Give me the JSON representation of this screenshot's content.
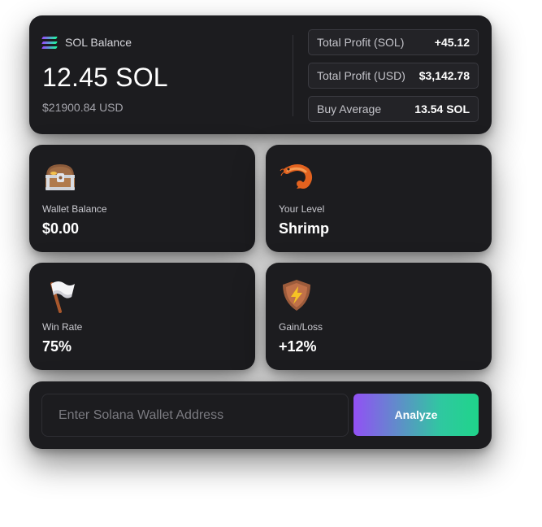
{
  "balance": {
    "label": "SOL Balance",
    "amount": "12.45 SOL",
    "usd": "$21900.84 USD",
    "icon": "solana-logo-icon"
  },
  "stats": [
    {
      "label": "Total Profit (SOL)",
      "value": "+45.12"
    },
    {
      "label": "Total Profit (USD)",
      "value": "$3,142.78"
    },
    {
      "label": "Buy Average",
      "value": "13.54 SOL"
    }
  ],
  "tiles": {
    "wallet": {
      "label": "Wallet Balance",
      "value": "$0.00",
      "icon": "treasure-chest-icon"
    },
    "level": {
      "label": "Your Level",
      "value": "Shrimp",
      "icon": "shrimp-icon"
    },
    "win": {
      "label": "Win Rate",
      "value": "75%",
      "icon": "white-flag-icon"
    },
    "gain": {
      "label": "Gain/Loss",
      "value": "+12%",
      "icon": "lightning-shield-icon"
    }
  },
  "input": {
    "placeholder": "Enter Solana Wallet Address",
    "value": ""
  },
  "analyze_button": "Analyze",
  "colors": {
    "card_bg": "#1c1c1f",
    "accent_from": "#9250f5",
    "accent_to": "#1fd48a"
  }
}
